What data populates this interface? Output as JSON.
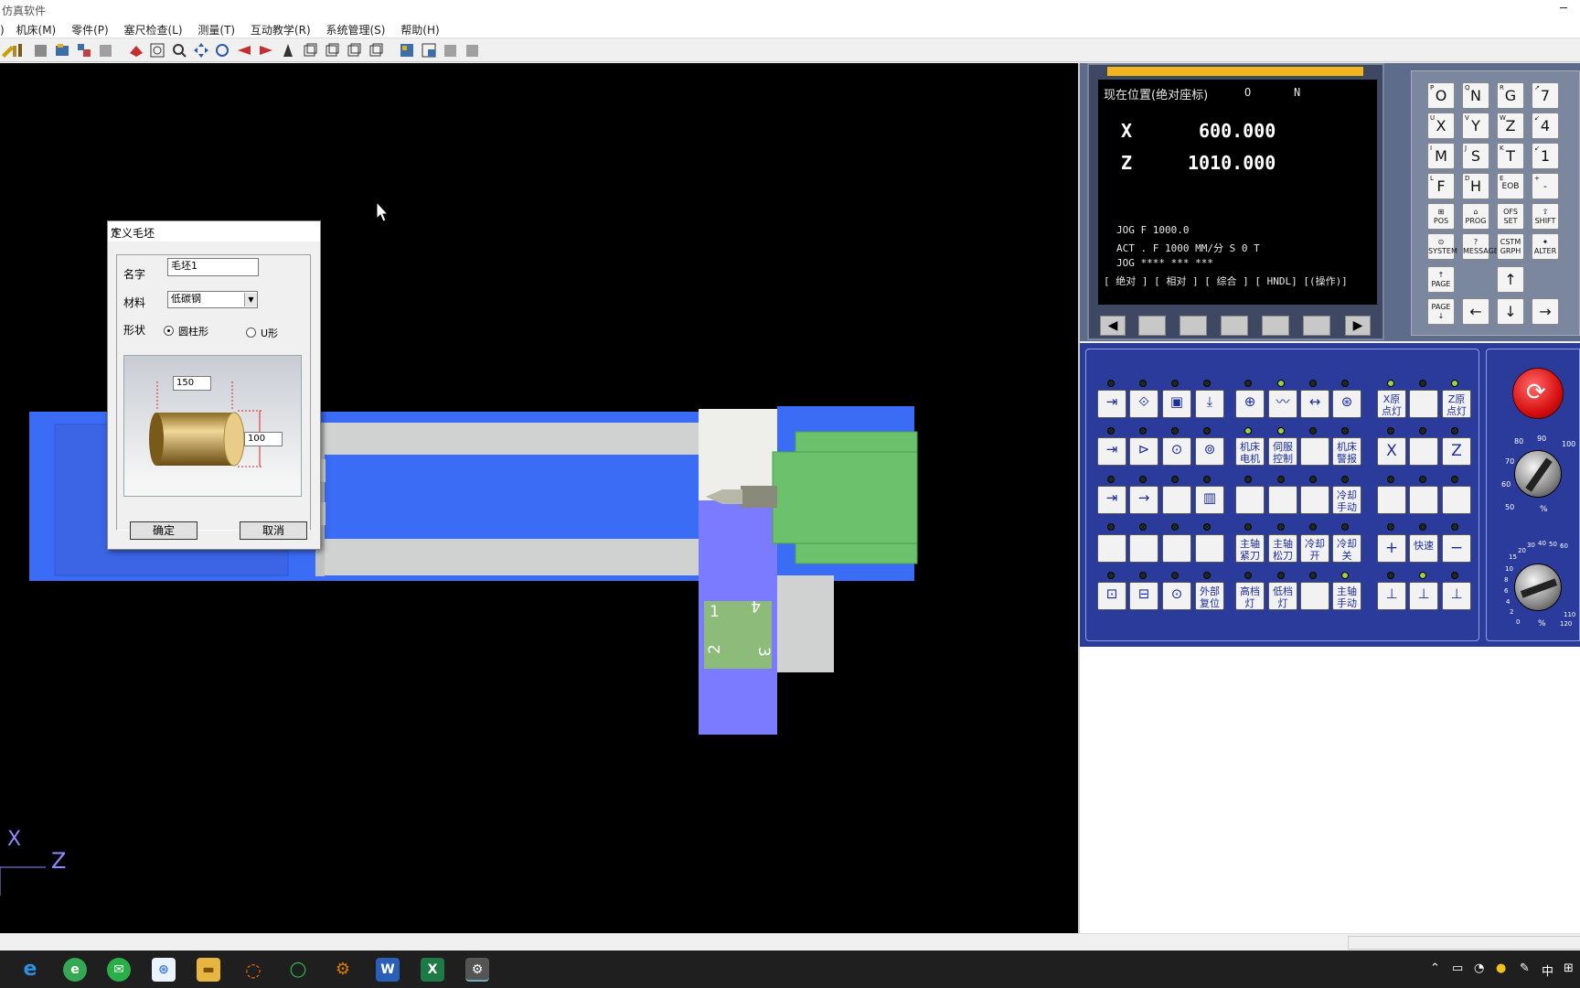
{
  "window": {
    "title": "仿真软件",
    "minimize": "─"
  },
  "menu": [
    "机床(M)",
    "零件(P)",
    "塞尺检查(L)",
    "测量(T)",
    "互动教学(R)",
    "系统管理(S)",
    "帮助(H)"
  ],
  "menu_partial": ")",
  "viewport": {
    "axis_x": "X",
    "axis_z": "Z"
  },
  "fixture_labels": [
    "1",
    "4",
    "2",
    "3"
  ],
  "dialog": {
    "title": "定义毛坯",
    "name_label": "名字",
    "name_value": "毛坯1",
    "material_label": "材料",
    "material_value": "低碳钢",
    "shape_label": "形状",
    "shape_option1": "圆柱形",
    "shape_option2": "U形",
    "length_value": "150",
    "diameter_value": "100",
    "ok": "确定",
    "cancel": "取消"
  },
  "cnc_screen": {
    "header": "现在位置(绝对座标)",
    "o_label": "O",
    "n_label": "N",
    "x_label": "X",
    "x_value": "600.000",
    "z_label": "Z",
    "z_value": "1010.000",
    "line1": "JOG  F  1000.0",
    "line2": "ACT . F 1000  MM/分     S  0   T",
    "line3": "JOG **** *** ***",
    "softkeys": "[ 绝对 ] [ 相对 ] [ 综合 ] [ HNDL]  [(操作)]"
  },
  "keypad": {
    "row1": [
      [
        "P",
        "O"
      ],
      [
        "Q",
        "N"
      ],
      [
        "R",
        "G"
      ],
      [
        "↗",
        "7"
      ]
    ],
    "row2": [
      [
        "U",
        "X"
      ],
      [
        "V",
        "Y"
      ],
      [
        "W",
        "Z"
      ],
      [
        "↙",
        "4"
      ]
    ],
    "row3": [
      [
        "I",
        "M"
      ],
      [
        "J",
        "S"
      ],
      [
        "K",
        "T"
      ],
      [
        "↙",
        "1"
      ]
    ],
    "row4": [
      [
        "L",
        "F"
      ],
      [
        "D",
        "H"
      ],
      [
        "E",
        "EOB"
      ],
      [
        "+",
        "-"
      ]
    ],
    "row5": [
      "POS",
      "PROG",
      "OFS SET",
      "SHIFT"
    ],
    "row6": [
      "SYSTEM",
      "MESSAGE",
      "CSTM GRPH",
      "ALTER"
    ],
    "page_up": "PAGE ↑",
    "page_down": "PAGE ↓",
    "arrows": [
      "↑",
      "←",
      "↓",
      "→"
    ]
  },
  "operator_panel": {
    "xhome": "X原\n点灯",
    "zhome": "Z原\n点灯",
    "machine_motor": "机床\n电机",
    "servo": "伺服\n控制",
    "machine_alarm": "机床\n警报",
    "x_axis": "X",
    "z_axis": "Z",
    "coolant_manual": "冷却\n手动",
    "spindle_clamp": "主轴\n紧刀",
    "spindle_release": "主轴\n松刀",
    "coolant_on": "冷却\n开",
    "coolant_off": "冷却\n关",
    "plus": "+",
    "rapid": "快速",
    "minus": "−",
    "external_reset": "外部\n复位",
    "high_gear": "高档\n灯",
    "low_gear": "低档\n灯",
    "spindle_manual": "主轴\n手动"
  },
  "dials": {
    "feed_override_ticks": [
      "80",
      "90",
      "100",
      "70",
      "60",
      "50"
    ],
    "spindle_override_ticks": [
      "20",
      "30",
      "40",
      "50",
      "60",
      "15",
      "10",
      "8",
      "6",
      "4",
      "2",
      "0",
      "110",
      "120"
    ],
    "percent": "%"
  },
  "taskbar": {
    "ime": "中"
  }
}
